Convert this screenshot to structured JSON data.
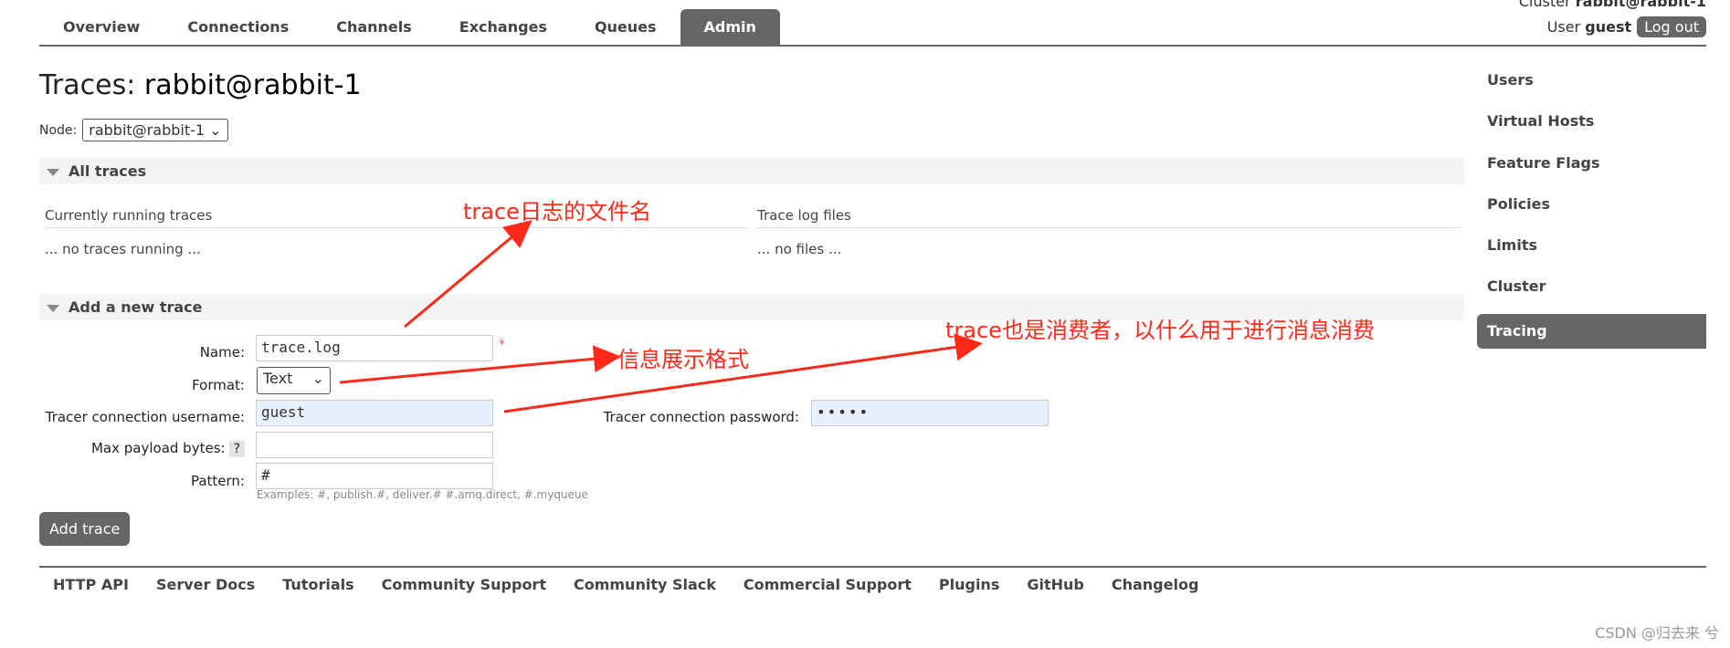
{
  "nav": {
    "tabs": [
      "Overview",
      "Connections",
      "Channels",
      "Exchanges",
      "Queues",
      "Admin"
    ],
    "active": "Admin"
  },
  "header": {
    "cluster_label": "Cluster",
    "cluster_name": "rabbit@rabbit-1",
    "user_label": "User",
    "user_name": "guest",
    "logout": "Log out"
  },
  "page": {
    "title_prefix": "Traces:",
    "title_node": "rabbit@rabbit-1",
    "node_label": "Node:",
    "node_value": "rabbit@rabbit-1"
  },
  "all_traces": {
    "title": "All traces",
    "running_header": "Currently running traces",
    "running_empty": "... no traces running ...",
    "files_header": "Trace log files",
    "files_empty": "... no files ..."
  },
  "add_trace": {
    "title": "Add a new trace",
    "name_label": "Name:",
    "name_value": "trace.log",
    "required": "*",
    "format_label": "Format:",
    "format_value": "Text",
    "username_label": "Tracer connection username:",
    "username_value": "guest",
    "password_label": "Tracer connection password:",
    "password_value": "•••••",
    "max_payload_label": "Max payload bytes:",
    "help": "?",
    "max_payload_value": "",
    "pattern_label": "Pattern:",
    "pattern_value": "#",
    "examples": "Examples: #, publish.#, deliver.# #.amq.direct, #.myqueue",
    "submit": "Add trace"
  },
  "sidebar": {
    "items": [
      "Users",
      "Virtual Hosts",
      "Feature Flags",
      "Policies",
      "Limits",
      "Cluster",
      "Tracing"
    ],
    "active": "Tracing"
  },
  "footer": {
    "links": [
      "HTTP API",
      "Server Docs",
      "Tutorials",
      "Community Support",
      "Community Slack",
      "Commercial Support",
      "Plugins",
      "GitHub",
      "Changelog"
    ]
  },
  "annotations": {
    "file_name": "trace日志的文件名",
    "format": "信息展示格式",
    "consumer": "trace也是消费者，以什么用于进行消息消费",
    "color": "#ff2a1a"
  },
  "watermark": "CSDN @归去来 兮"
}
